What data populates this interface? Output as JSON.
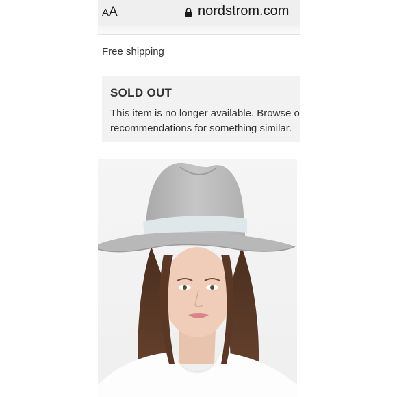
{
  "browser": {
    "text_size_label": "AA",
    "url": "nordstrom.com"
  },
  "product": {
    "shipping_text": "Free shipping",
    "status_title": "SOLD OUT",
    "status_message_line1": "This item is no longer available. Browse our",
    "status_message_line2": "recommendations for something similar."
  },
  "colors": {
    "hat": "#bcbcbc",
    "hat_band": "#dfe7ea",
    "panel": "#f2f2f2"
  }
}
